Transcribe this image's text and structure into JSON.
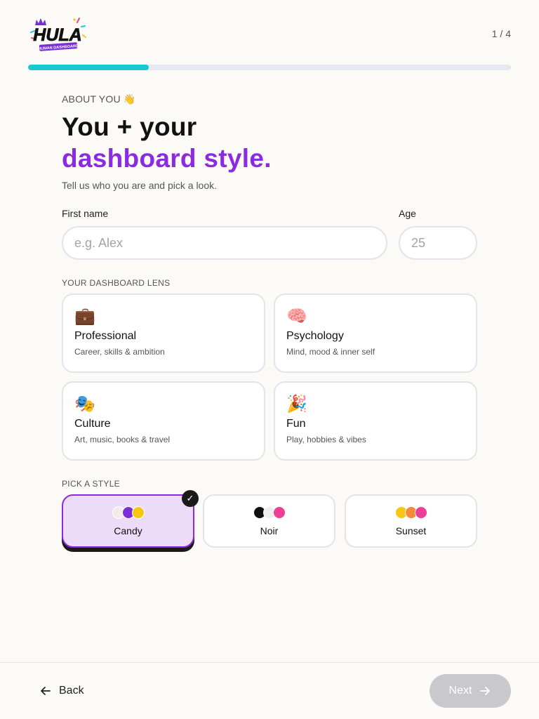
{
  "header": {
    "logo_text": "HULA",
    "logo_subtext": "HUMAN DASHBOARD",
    "step_counter": "1 / 4",
    "progress_percent": 25
  },
  "intro": {
    "eyebrow": "ABOUT YOU",
    "eyebrow_emoji": "👋",
    "headline_line1": "You + your",
    "headline_line2": "dashboard style.",
    "subtitle": "Tell us who you are and pick a look."
  },
  "form": {
    "name_label": "First name",
    "name_placeholder": "e.g. Alex",
    "name_value": "",
    "age_label": "Age",
    "age_placeholder": "25",
    "age_value": ""
  },
  "lens": {
    "title": "YOUR DASHBOARD LENS",
    "options": [
      {
        "emoji": "💼",
        "name": "Professional",
        "desc": "Career, skills & ambition"
      },
      {
        "emoji": "🧠",
        "name": "Psychology",
        "desc": "Mind, mood & inner self"
      },
      {
        "emoji": "🎭",
        "name": "Culture",
        "desc": "Art, music, books & travel"
      },
      {
        "emoji": "🎉",
        "name": "Fun",
        "desc": "Play, hobbies & vibes"
      }
    ]
  },
  "styles": {
    "title": "PICK A STYLE",
    "selected": "Candy",
    "check_glyph": "✓",
    "options": [
      {
        "name": "Candy",
        "swatches": [
          "#f3ebe6",
          "#7a2ed6",
          "#f8c511"
        ]
      },
      {
        "name": "Noir",
        "swatches": [
          "#111111",
          "#efefef",
          "#ec3f95"
        ]
      },
      {
        "name": "Sunset",
        "swatches": [
          "#f8c511",
          "#f58a3a",
          "#ec3f95"
        ]
      }
    ]
  },
  "footer": {
    "back_label": "Back",
    "next_label": "Next"
  },
  "colors": {
    "accent": "#8a2be2",
    "progress": "#17c9d0",
    "disabled_button": "#c9c9cd"
  }
}
